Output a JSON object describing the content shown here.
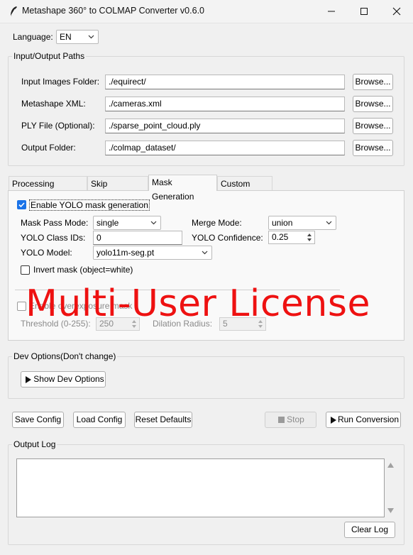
{
  "window": {
    "title": "Metashape 360° to COLMAP Converter v0.6.0",
    "icon": "feather-icon",
    "controls": [
      "minimize-icon",
      "maximize-icon",
      "close-icon"
    ]
  },
  "language": {
    "label": "Language:",
    "value": "EN"
  },
  "paths": {
    "group_title": "Input/Output Paths",
    "rows": [
      {
        "label": "Input Images Folder:",
        "value": "./equirect/",
        "button": "Browse..."
      },
      {
        "label": "Metashape XML:",
        "value": "./cameras.xml",
        "button": "Browse..."
      },
      {
        "label": "PLY File (Optional):",
        "value": "./sparse_point_cloud.ply",
        "button": "Browse..."
      },
      {
        "label": "Output Folder:",
        "value": "./colmap_dataset/",
        "button": "Browse..."
      }
    ]
  },
  "tabs": {
    "items": [
      "Processing Options",
      "Skip Directions",
      "Mask Generation",
      "Custom Mask"
    ],
    "active": "Mask Generation"
  },
  "mask": {
    "enable_yolo": {
      "label": "Enable YOLO mask generation",
      "checked": true
    },
    "pass_mode": {
      "label": "Mask Pass Mode:",
      "value": "single"
    },
    "merge_mode": {
      "label": "Merge Mode:",
      "value": "union"
    },
    "class_ids": {
      "label": "YOLO Class IDs:",
      "value": "0"
    },
    "confidence": {
      "label": "YOLO Confidence:",
      "value": "0.25"
    },
    "model": {
      "label": "YOLO Model:",
      "value": "yolo11m-seg.pt"
    },
    "invert": {
      "label": "Invert mask (object=white)",
      "checked": false
    },
    "overexposure": {
      "label": "Enable overexposure mask",
      "checked": false
    },
    "threshold": {
      "label": "Threshold (0-255):",
      "value": "250"
    },
    "dilation": {
      "label": "Dilation Radius:",
      "value": "5"
    }
  },
  "dev": {
    "group_title": "Dev Options(Don't change)",
    "button": "Show Dev Options"
  },
  "actions": {
    "save": "Save Config",
    "load": "Load Config",
    "reset": "Reset Defaults",
    "stop": "Stop",
    "run": "Run Conversion"
  },
  "log": {
    "group_title": "Output Log",
    "content": "",
    "clear": "Clear Log"
  },
  "watermark": "Multi-User License",
  "colors": {
    "accent": "#1a73e8",
    "watermark": "#ee1111",
    "background": "#f0f0f0"
  }
}
